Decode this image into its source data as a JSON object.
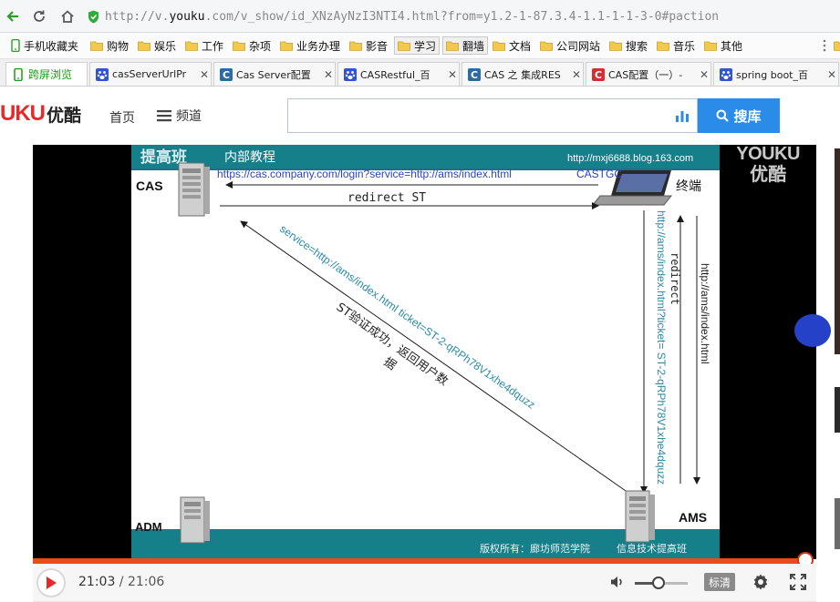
{
  "browser": {
    "url_prefix": "http://v.",
    "url_domain": "youku",
    "url_rest": ".com/v_show/id_XNzAyNzI3NTI4.html?from=y1.2-1-87.3.4-1.1-1-1-3-0#paction"
  },
  "bookmarks": [
    {
      "label": "手机收藏夹"
    },
    {
      "label": "购物"
    },
    {
      "label": "娱乐"
    },
    {
      "label": "工作"
    },
    {
      "label": "杂项"
    },
    {
      "label": "业务办理"
    },
    {
      "label": "影音"
    },
    {
      "label": "学习"
    },
    {
      "label": "翻墙"
    },
    {
      "label": "文档"
    },
    {
      "label": "公司网站"
    },
    {
      "label": "搜索"
    },
    {
      "label": "音乐"
    },
    {
      "label": "其他"
    }
  ],
  "tabs": [
    {
      "label": "跨屏浏览"
    },
    {
      "label": "casServerUrlPr"
    },
    {
      "label": "Cas Server配置"
    },
    {
      "label": "CASRestful_百"
    },
    {
      "label": "CAS 之 集成RES"
    },
    {
      "label": "CAS配置（一）-"
    },
    {
      "label": "spring boot_百"
    }
  ],
  "site": {
    "logo_text": "UKU",
    "logo_cn": "优酷",
    "nav_home": "首页",
    "nav_channel": "频道",
    "search_value": "",
    "search_button": "搜库",
    "brand_color": "#e8282b",
    "search_color": "#2a8be8"
  },
  "video": {
    "slide": {
      "header_logo": "提高班",
      "header_title": "内部教程",
      "blog": "http://mxj6688.blog.163.com",
      "cas": "CAS",
      "terminal": "终端",
      "ams": "AMS",
      "adm": "ADM",
      "login_url": "https://cas.company.com/login?service=http://ams/index.html",
      "castgc": "CASTGC",
      "redirect_st": "redirect  ST",
      "service_ticket": "service=http://ams/index.html     ticket=ST-2-qRPh78V1xhe4dquzz",
      "st_verify_1": "ST验证成功，返回用户数",
      "st_verify_2": "据",
      "ticket_url": "http://ams/index.html?ticket=  ST-2-qRPh78V1xhe4dquzz",
      "redirect": "redirect",
      "ams_url": "http://ams/index.html",
      "footer_1": "版权所有：廊坊师范学院",
      "footer_2": "信息技术提高班"
    },
    "watermark_en": "YOUKU",
    "watermark_cn": "优酷",
    "current_time": "21:03",
    "duration": "21:06",
    "time_separator": " / ",
    "progress": 0.998,
    "volume": 0.45,
    "quality_label": "标清",
    "progress_color": "#e74c1c"
  }
}
